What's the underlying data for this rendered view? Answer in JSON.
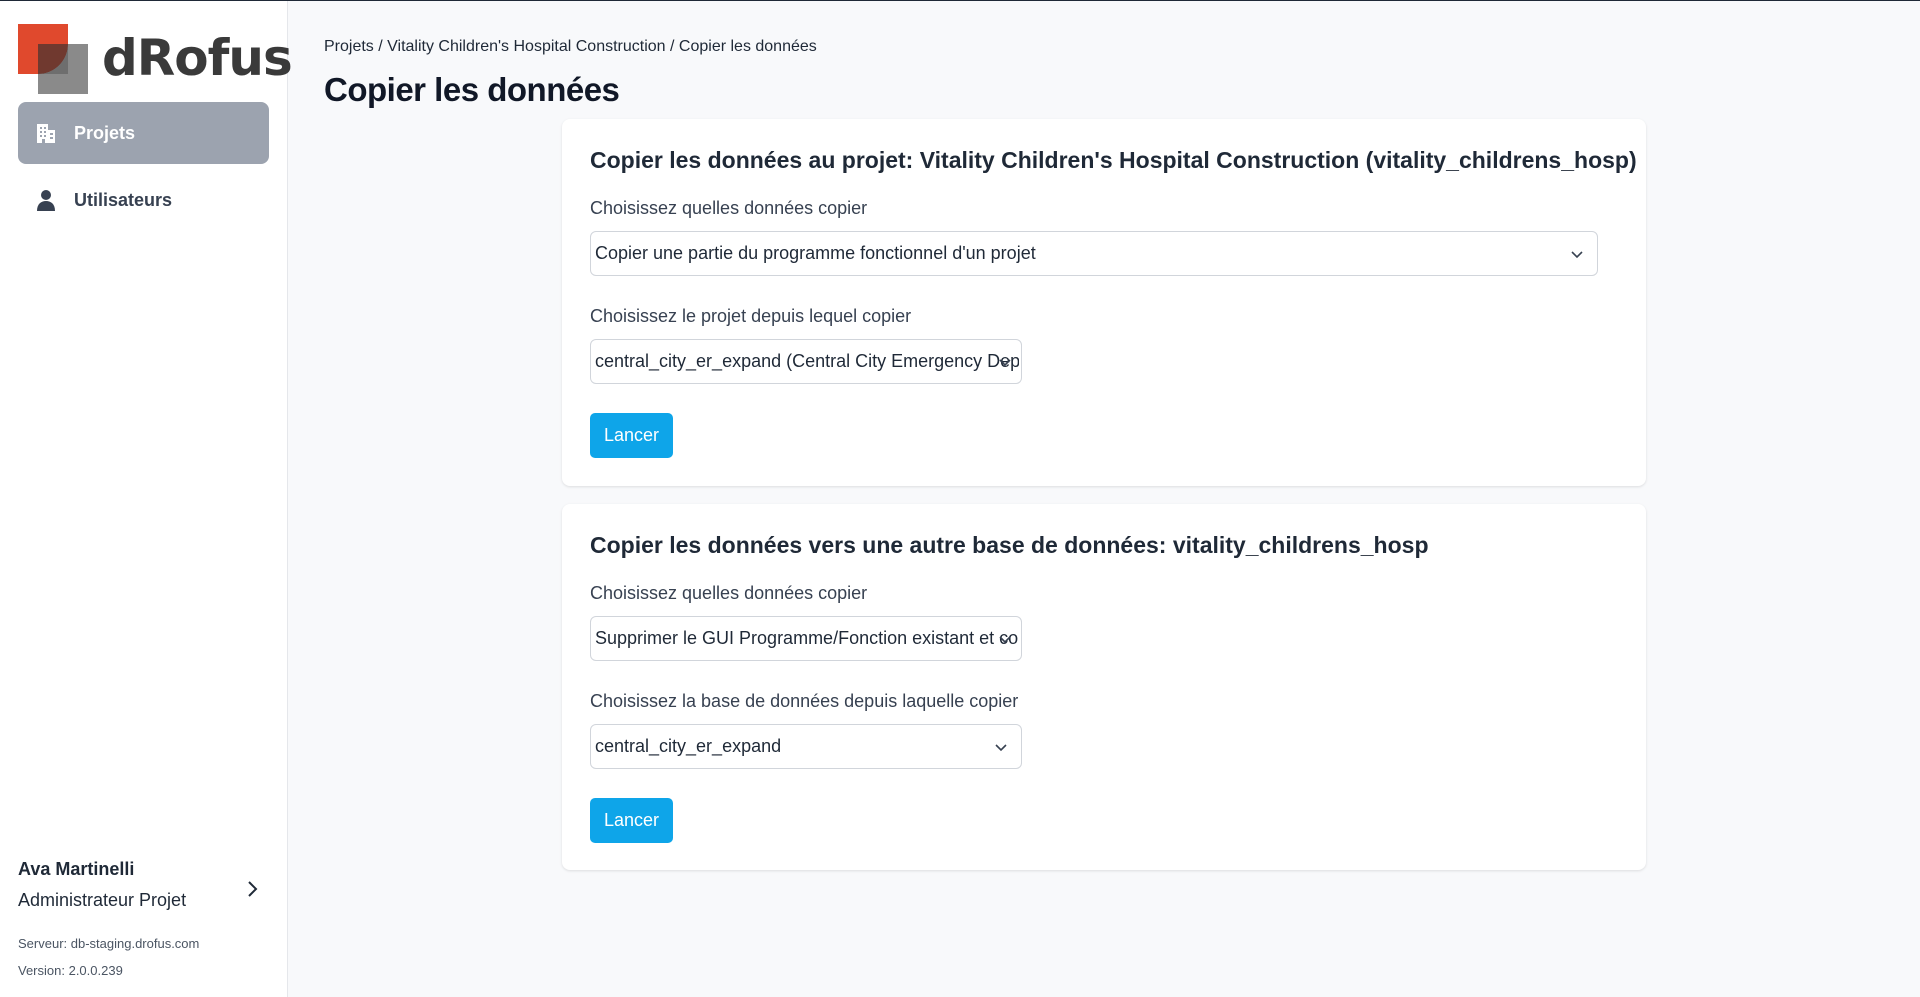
{
  "brand": {
    "name": "dRofus"
  },
  "sidebar": {
    "items": [
      {
        "label": "Projets",
        "icon": "building-icon",
        "active": true
      },
      {
        "label": "Utilisateurs",
        "icon": "user-icon",
        "active": false
      }
    ]
  },
  "user": {
    "name": "Ava Martinelli",
    "role": "Administrateur Projet",
    "server": "Serveur: db-staging.drofus.com",
    "version": "Version: 2.0.0.239"
  },
  "breadcrumb": "Projets / Vitality Children's Hospital Construction / Copier les données",
  "page_title": "Copier les données",
  "card1": {
    "title": "Copier les données au projet: Vitality Children's Hospital Construction (vitality_childrens_hosp)",
    "data_label": "Choisissez quelles données copier",
    "data_value": "Copier une partie du programme fonctionnel d'un projet",
    "source_label": "Choisissez le projet depuis lequel copier",
    "source_value": "central_city_er_expand (Central City Emergency Department Expansion)",
    "button": "Lancer"
  },
  "card2": {
    "title": "Copier les données vers une autre base de données: vitality_childrens_hosp",
    "data_label": "Choisissez quelles données copier",
    "data_value": "Supprimer le GUI Programme/Fonction existant et copier",
    "source_label": "Choisissez la base de données depuis laquelle copier",
    "source_value": "central_city_er_expand",
    "button": "Lancer"
  },
  "colors": {
    "accent": "#0ea5e9",
    "nav_active_bg": "#9ca3af",
    "logo_red": "#e0492d",
    "logo_grey": "#8a8a8a"
  }
}
